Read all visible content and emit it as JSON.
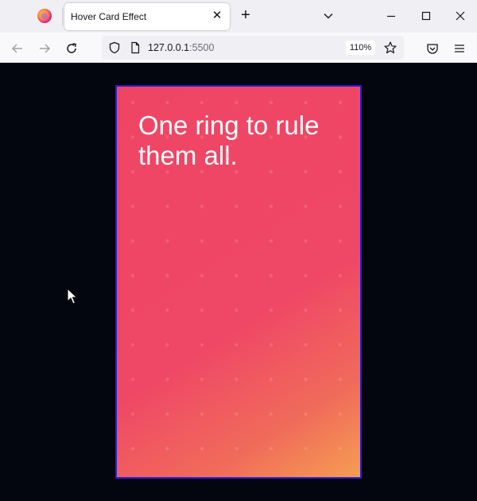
{
  "browser": {
    "tab_title": "Hover Card Effect",
    "tab_close_glyph": "✕",
    "new_tab_glyph": "+",
    "url_host": "127.0.0.1",
    "url_port": ":5500",
    "zoom": "110%"
  },
  "card": {
    "heading": "One ring to rule them all.",
    "gradient_colors": [
      "#ef4565",
      "#f59e52"
    ],
    "border_color": "#2b1bd8"
  },
  "colors": {
    "page_background": "#03060f",
    "accent": "#ef4565"
  },
  "icons": {
    "browser_logo": "firefox-logo-icon",
    "list_tabs": "chevron-down-icon",
    "minimize": "minimize-icon",
    "maximize": "maximize-icon",
    "close_window": "close-icon",
    "back": "back-arrow-icon",
    "forward": "forward-arrow-icon",
    "reload": "reload-icon",
    "tracking_protection": "shield-icon",
    "page_info": "page-icon",
    "bookmark": "star-icon",
    "pocket": "pocket-icon",
    "menu": "hamburger-menu-icon",
    "pointer": "mouse-cursor-icon"
  }
}
